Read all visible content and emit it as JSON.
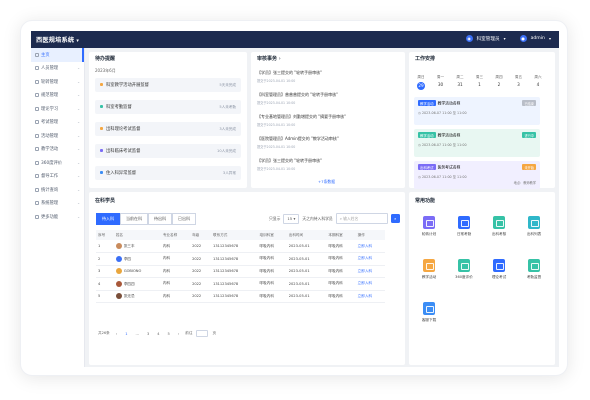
{
  "app": {
    "title": "西医规培系统",
    "dept_label": "科室管理员",
    "user_label": "admin"
  },
  "colors": {
    "accent": "#2f6bff",
    "topbar": "#1d2b4f"
  },
  "sidebar": {
    "items": [
      {
        "label": "主页",
        "active": true
      },
      {
        "label": "人员管理"
      },
      {
        "label": "轮转管理"
      },
      {
        "label": "规范管理"
      },
      {
        "label": "理论学习"
      },
      {
        "label": "考试管理"
      },
      {
        "label": "活动管理"
      },
      {
        "label": "教学活动"
      },
      {
        "label": "360度评价"
      },
      {
        "label": "督导工作"
      },
      {
        "label": "统计查询"
      },
      {
        "label": "系统管理"
      },
      {
        "label": "更多功能"
      }
    ]
  },
  "todo": {
    "title": "待办提醒",
    "month": "2023年6月",
    "items": [
      {
        "label": "科室教学活动开展监督",
        "count": "5天未完成",
        "color": "#f5a742"
      },
      {
        "label": "科室考勤监督",
        "count": "5人未考勤",
        "color": "#36c2a6"
      },
      {
        "label": "出科理论考试监督",
        "count": "3人未完成",
        "color": "#f5a742"
      },
      {
        "label": "出科临床考试监督",
        "count": "10人未完成",
        "color": "#7b6cf6"
      },
      {
        "label": "住入科异常监督",
        "count": "3人异常",
        "color": "#3b8df5"
      }
    ]
  },
  "news": {
    "title": "审核事务",
    "items": [
      {
        "title": "【学员】张三提交的 \"轮转手册审核\"",
        "date": "提交于2023-04-01 10:00"
      },
      {
        "title": "【科室管理员】普普普提交的 \"轮转手册审核\"",
        "date": "提交于2023-04-01 10:00"
      },
      {
        "title": "【专业基地管理员】刘勤增提交的 \"摘要手册审核\"",
        "date": "提交于2023-04-01 10:00"
      },
      {
        "title": "【医院管理员】Admin提交的 \"教学活动审核\"",
        "date": "提交于2023-04-01 10:00"
      },
      {
        "title": "【学员】张三提交的 \"轮转手册审核\"",
        "date": "提交于2023-04-01 10:00"
      }
    ],
    "more": "+7条数据"
  },
  "schedule": {
    "title": "工作安排",
    "days": [
      {
        "w": "周日",
        "n": "29",
        "today": true
      },
      {
        "w": "周一",
        "n": "30"
      },
      {
        "w": "周二",
        "n": "31"
      },
      {
        "w": "周三",
        "n": "1"
      },
      {
        "w": "周四",
        "n": "2"
      },
      {
        "w": "周五",
        "n": "3"
      },
      {
        "w": "周六",
        "n": "4"
      }
    ],
    "items": [
      {
        "tag": "教学活动",
        "title": "教学活动名称",
        "badge": "已结束",
        "time": "2023-06-07 11:00 至 11:00",
        "loc": "",
        "tag_color": "#2f6bff",
        "badge_color": "#b9bec8",
        "bg": "#eef4ff"
      },
      {
        "tag": "教学活动",
        "title": "教学活动名称",
        "badge": "进行中",
        "time": "2023-06-07 11:00 至 11:00",
        "loc": "",
        "tag_color": "#36c2a6",
        "badge_color": "#36c2a6",
        "bg": "#e8f7f2"
      },
      {
        "tag": "出科考试",
        "title": "医务考试名称",
        "badge": "未开始",
        "time": "2023-06-07 11:00 至 11:00",
        "loc": "地点：教师教学",
        "tag_color": "#7b6cf6",
        "badge_color": "#f5a742",
        "bg": "#f1efff"
      }
    ]
  },
  "roster": {
    "title": "在科学员",
    "tabs": [
      "待入科",
      "当前在科",
      "待出科",
      "已出科"
    ],
    "filter_label": "只显示",
    "filter_value": "15",
    "filter_suffix": "天之内待入科学员",
    "search_placeholder": "输入姓名",
    "columns": [
      "序号",
      "姓名",
      "专业名称",
      "年级",
      "联系方式",
      "培训科室",
      "出科时间",
      "本期科室",
      "操作"
    ],
    "rows": [
      {
        "no": "1",
        "name": "张三丰",
        "major": "内科",
        "grade": "2022",
        "phone": "13112345678",
        "dept": "呼吸内科",
        "date": "2023-05-01",
        "cur": "呼吸内科",
        "op": "立即入科",
        "av": "#c98b5c"
      },
      {
        "no": "2",
        "name": "李四",
        "major": "内科",
        "grade": "2022",
        "phone": "13112345678",
        "dept": "呼吸内科",
        "date": "2023-05-01",
        "cur": "呼吸内科",
        "op": "立即入科",
        "av": "#3b6ff5"
      },
      {
        "no": "3",
        "name": "GOBIONO",
        "major": "内科",
        "grade": "2022",
        "phone": "13112345678",
        "dept": "呼吸内科",
        "date": "2023-05-01",
        "cur": "呼吸内科",
        "op": "立即入科",
        "av": "#e9a63d"
      },
      {
        "no": "4",
        "name": "李四四",
        "major": "内科",
        "grade": "2022",
        "phone": "13112345678",
        "dept": "呼吸内科",
        "date": "2023-05-01",
        "cur": "呼吸内科",
        "op": "立即入科",
        "av": "#a8583a"
      },
      {
        "no": "5",
        "name": "张无忌",
        "major": "内科",
        "grade": "2022",
        "phone": "13112345678",
        "dept": "呼吸内科",
        "date": "2023-05-01",
        "cur": "呼吸内科",
        "op": "立即入科",
        "av": "#7a4f3a"
      }
    ],
    "pager": {
      "total": "共26条",
      "pages": [
        "1",
        "...",
        "3",
        "4",
        "5"
      ],
      "current": "1",
      "goto": "前往",
      "page_suffix": "页"
    }
  },
  "functions": {
    "title": "常用功能",
    "items": [
      {
        "label": "轮转计划",
        "color": "#7b6cf6"
      },
      {
        "label": "日常考勤",
        "color": "#2f6bff"
      },
      {
        "label": "出科考核",
        "color": "#36c2a6"
      },
      {
        "label": "出科列表",
        "color": "#2fb7c9"
      },
      {
        "label": "教学活动",
        "color": "#f5a742"
      },
      {
        "label": "360度评价",
        "color": "#36c2a6"
      },
      {
        "label": "理论考试",
        "color": "#2f6bff"
      },
      {
        "label": "考勤监督",
        "color": "#36c2a6"
      },
      {
        "label": "客服下载",
        "color": "#3b8df5"
      }
    ]
  }
}
